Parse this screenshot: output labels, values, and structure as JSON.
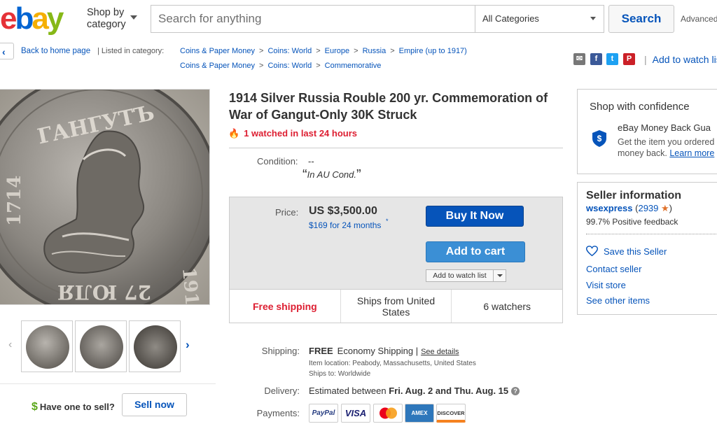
{
  "header": {
    "logo_letters": [
      "e",
      "b",
      "a",
      "y"
    ],
    "shop_by_line1": "Shop by",
    "shop_by_line2": "category",
    "search_placeholder": "Search for anything",
    "category_value": "All Categories",
    "search_button": "Search",
    "advanced_link": "Advanced"
  },
  "breadcrumb": {
    "back_label": "Back to home page",
    "listed_label": "| Listed in category:",
    "row1": [
      "Coins & Paper Money",
      "Coins: World",
      "Europe",
      "Russia",
      "Empire (up to 1917)"
    ],
    "row2": [
      "Coins & Paper Money",
      "Coins: World",
      "Commemorative"
    ],
    "separator": ">"
  },
  "share": {
    "icons": [
      "email-icon",
      "facebook-icon",
      "twitter-icon",
      "pinterest-icon"
    ],
    "watch_link": "Add to watch list"
  },
  "gallery": {
    "thumbnails": [
      "coin-obverse-thumb",
      "coin-obverse-angle-thumb",
      "coin-reverse-thumb"
    ],
    "have_one": "Have one to sell?",
    "sell_now": "Sell now"
  },
  "item": {
    "title": "1914 Silver Russia Rouble 200 yr. Commemoration of War of Gangut-Only 30K Struck",
    "hot_signal": "1 watched in last 24 hours",
    "condition_label": "Condition:",
    "condition_value": "--",
    "condition_note": "In AU Cond.",
    "price_label": "Price:",
    "price": "US $3,500.00",
    "monthly": "$169 for 24 months",
    "monthly_mark": "*",
    "buy_now": "Buy It Now",
    "add_to_cart": "Add to cart",
    "add_to_watch": "Add to watch list",
    "features": [
      "Free shipping",
      "Ships from United States",
      "6 watchers"
    ],
    "shipping_label": "Shipping:",
    "shipping_free": "FREE",
    "shipping_method": "Economy Shipping",
    "shipping_sep": "|",
    "see_details": "See details",
    "item_location": "Item location:  Peabody, Massachusetts, United States",
    "ships_to": "Ships to:  Worldwide",
    "delivery_label": "Delivery:",
    "delivery_prefix": "Estimated between",
    "delivery_dates": "Fri. Aug. 2 and Thu. Aug. 15",
    "payments_label": "Payments:",
    "payment_methods": [
      "PayPal",
      "VISA",
      "MasterCard",
      "AMEX",
      "DISCOVER"
    ]
  },
  "confidence": {
    "title": "Shop with confidence",
    "guarantee_title": "eBay Money Back Gua",
    "guarantee_line1": "Get the item you ordered",
    "guarantee_line2": "money back.",
    "learn_more": "Learn more"
  },
  "seller": {
    "title": "Seller information",
    "username": "wsexpress",
    "feedback_open": "(",
    "feedback_count": "2939",
    "feedback_close": ")",
    "positive": "99.7% Positive feedback",
    "save_seller": "Save this Seller",
    "contact": "Contact seller",
    "visit_store": "Visit store",
    "other_items": "See other items"
  },
  "colors": {
    "ebay_blue": "#0654ba",
    "alert_red": "#dd1e31",
    "cart_blue": "#3b8fd5"
  }
}
